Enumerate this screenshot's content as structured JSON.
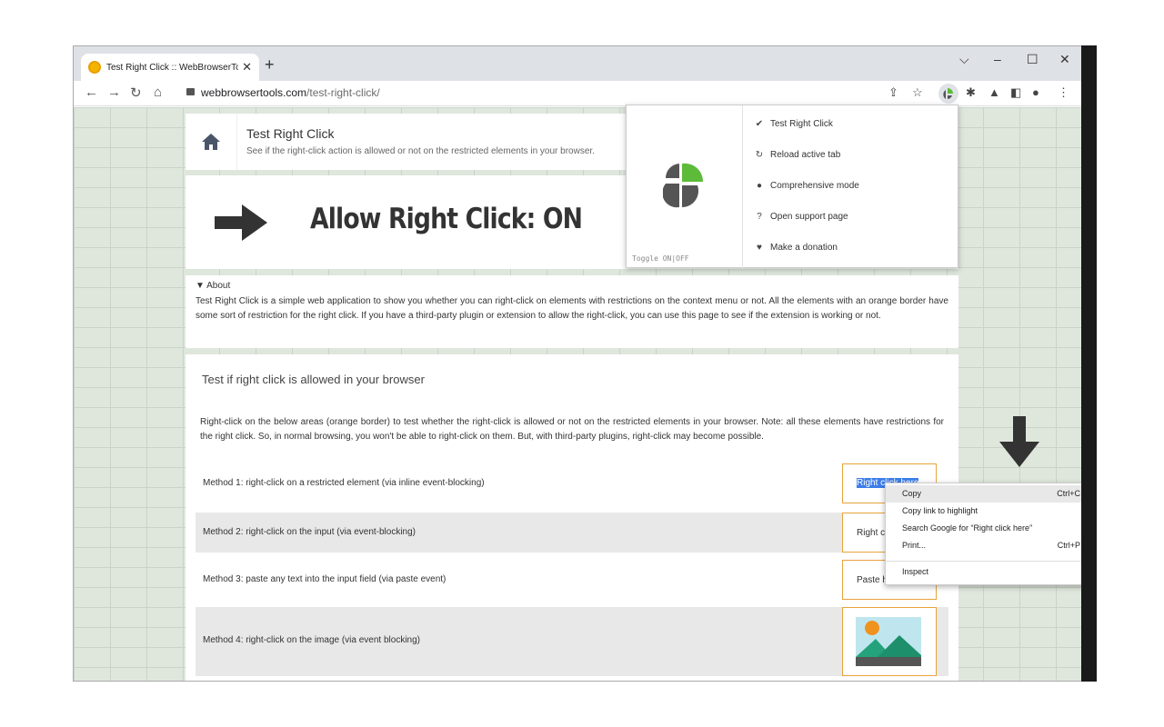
{
  "browser": {
    "tab_title": "Test Right Click :: WebBrowserTools",
    "tab_close": "✕",
    "new_tab": "+",
    "window_controls": {
      "dropdown": "⌵",
      "minimize": "–",
      "maximize": "☐",
      "close": "✕"
    },
    "url_host": "webbrowsertools.com",
    "url_path": "/test-right-click/"
  },
  "header": {
    "title": "Test Right Click",
    "subtitle": "See if the right-click action is allowed or not on the restricted elements in your browser."
  },
  "status": {
    "text": "Allow Right Click: ON"
  },
  "about": {
    "heading": "▼ About",
    "text": "Test Right Click is a simple web application to show you whether you can right-click on elements with restrictions on the context menu or not. All the elements with an orange border have some sort of restriction for the right click. If you have a third-party plugin or extension to allow the right-click, you can use this page to see if the extension is working or not."
  },
  "test": {
    "title": "Test if right click is allowed in your browser",
    "description": "Right-click on the below areas (orange border) to test whether the right-click is allowed or not on the restricted elements in your browser. Note: all these elements have restrictions for the right click. So, in normal browsing, you won't be able to right-click on them. But, with third-party plugins, right-click may become possible.",
    "methods": [
      {
        "label": "Method 1: right-click on a restricted element (via inline event-blocking)",
        "box_text": "Right click here"
      },
      {
        "label": "Method 2: right-click on the input (via event-blocking)",
        "box_text": "Right click here"
      },
      {
        "label": "Method 3: paste any text into the input field (via paste event)",
        "box_text": "Paste here"
      },
      {
        "label": "Method 4: right-click on the image (via event blocking)"
      }
    ]
  },
  "extension_popup": {
    "toggle_label": "Toggle ON|OFF",
    "items": [
      {
        "icon": "✔",
        "label": "Test Right Click"
      },
      {
        "icon": "↻",
        "label": "Reload active tab"
      },
      {
        "icon": "●",
        "label": "Comprehensive mode"
      },
      {
        "icon": "?",
        "label": "Open support page"
      },
      {
        "icon": "♥",
        "label": "Make a donation"
      }
    ]
  },
  "context_menu": {
    "items": [
      {
        "label": "Copy",
        "shortcut": "Ctrl+C"
      },
      {
        "label": "Copy link to highlight",
        "shortcut": ""
      },
      {
        "label": "Search Google for “Right click here”",
        "shortcut": ""
      },
      {
        "label": "Print...",
        "shortcut": "Ctrl+P"
      },
      {
        "label": "Inspect",
        "shortcut": ""
      }
    ]
  },
  "colors": {
    "accent_orange": "#e8a33d",
    "selection_blue": "#3b7de9",
    "logo_green": "#5dbb3a",
    "logo_gray": "#555555"
  }
}
